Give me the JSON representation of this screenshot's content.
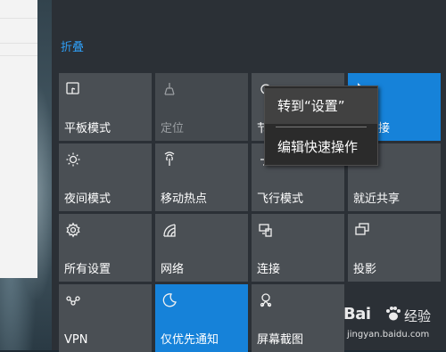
{
  "collapse_label": "折叠",
  "tiles": {
    "tablet": {
      "label": "平板模式",
      "icon": "tablet-mode-icon"
    },
    "location": {
      "label": "定位",
      "icon": "location-icon"
    },
    "hidden": {
      "label": "节",
      "icon": "battery-saver-icon"
    },
    "connect_top": {
      "label": "接",
      "icon": "cursor-icon"
    },
    "night": {
      "label": "夜间模式",
      "icon": "brightness-icon"
    },
    "hotspot": {
      "label": "移动热点",
      "icon": "hotspot-icon"
    },
    "airplane": {
      "label": "飞行模式",
      "icon": "airplane-icon"
    },
    "nearby": {
      "label": "就近共享",
      "icon": "nearby-share-icon"
    },
    "settings": {
      "label": "所有设置",
      "icon": "gear-icon"
    },
    "network": {
      "label": "网络",
      "icon": "network-icon"
    },
    "connect": {
      "label": "连接",
      "icon": "connect-icon"
    },
    "project": {
      "label": "投影",
      "icon": "project-icon"
    },
    "vpn": {
      "label": "VPN",
      "icon": "vpn-icon"
    },
    "focus": {
      "label": "仅优先通知",
      "icon": "moon-icon"
    },
    "snip": {
      "label": "屏幕截图",
      "icon": "snip-icon"
    }
  },
  "context_menu": {
    "items": [
      "转到“设置”",
      "编辑快速操作"
    ]
  },
  "watermark": {
    "brand": "Bai",
    "cn": "经验",
    "url": "jingyan.baidu.com"
  },
  "colors": {
    "accent": "#1682d9",
    "link": "#2f9ef5",
    "tile": "#4a4f54",
    "panel": "#2b3036"
  }
}
